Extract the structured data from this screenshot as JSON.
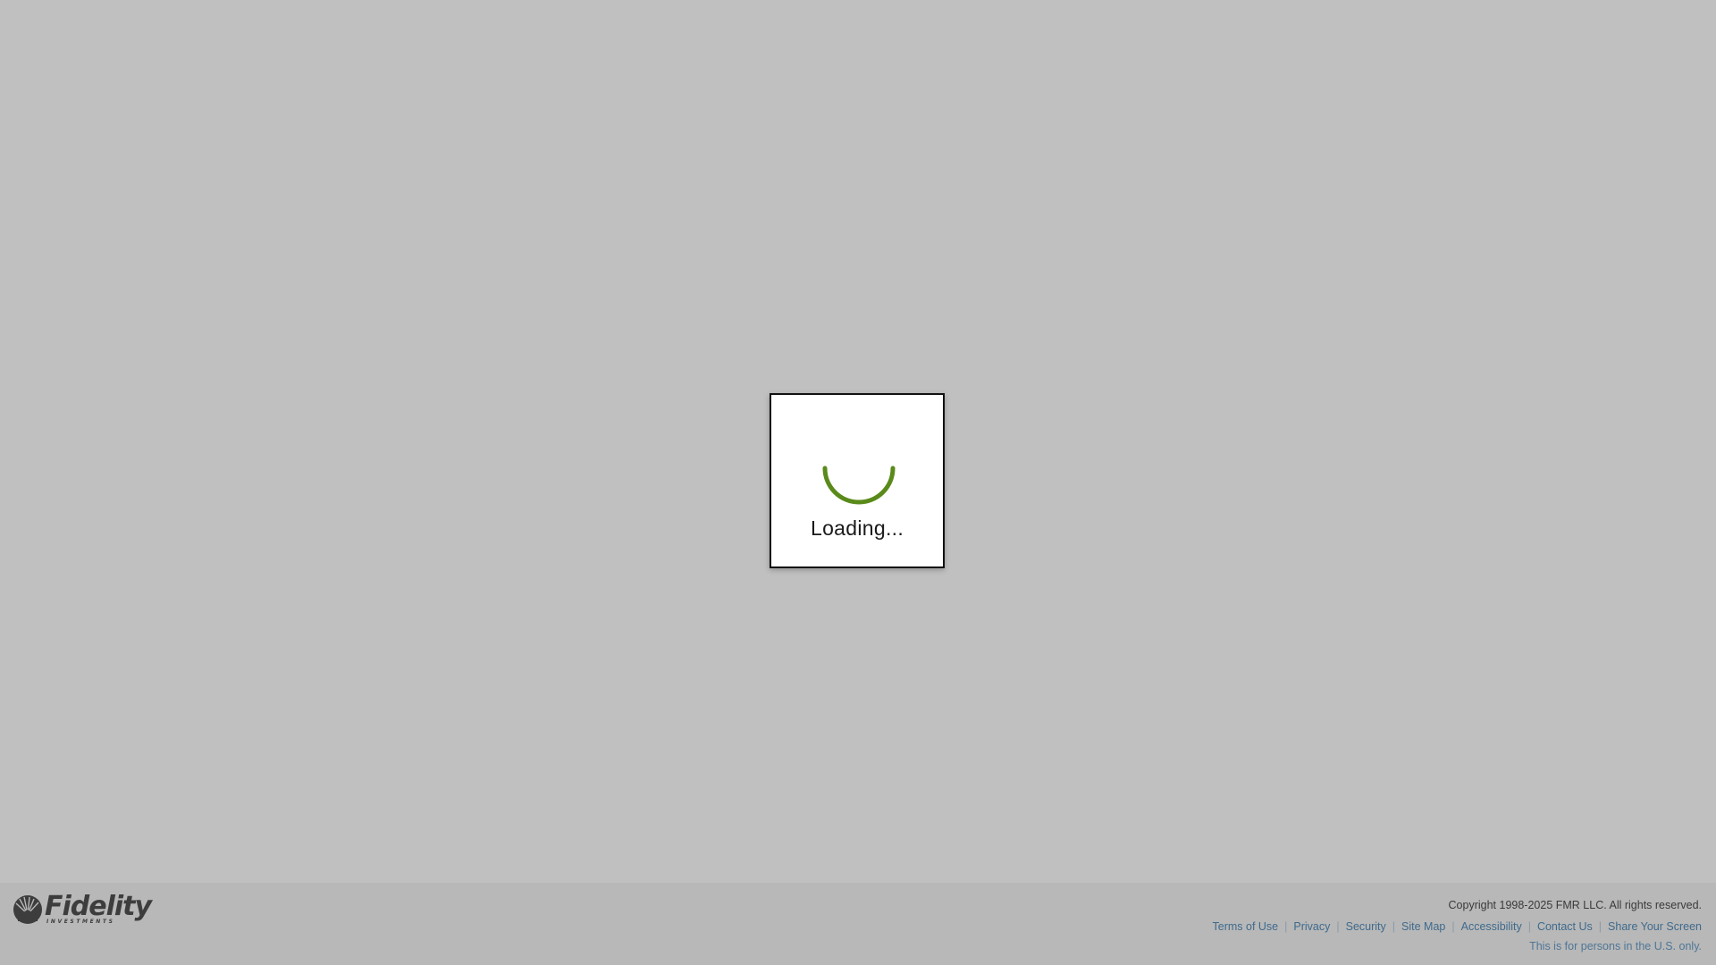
{
  "loading": {
    "text": "Loading...",
    "spinner_color": "#5a8a1a"
  },
  "footer": {
    "logo": {
      "name": "Fidelity",
      "subtitle": "INVESTMENTS",
      "icon": "fidelity-pyramid-icon"
    },
    "copyright": "Copyright 1998-2025 FMR LLC. All rights reserved.",
    "links": [
      {
        "label": "Terms of Use"
      },
      {
        "label": "Privacy"
      },
      {
        "label": "Security"
      },
      {
        "label": "Site Map"
      },
      {
        "label": "Accessibility"
      },
      {
        "label": "Contact Us"
      },
      {
        "label": "Share Your Screen"
      }
    ],
    "disclaimer": "This is for persons in the U.S. only.",
    "link_color": "#3f6a8c"
  }
}
